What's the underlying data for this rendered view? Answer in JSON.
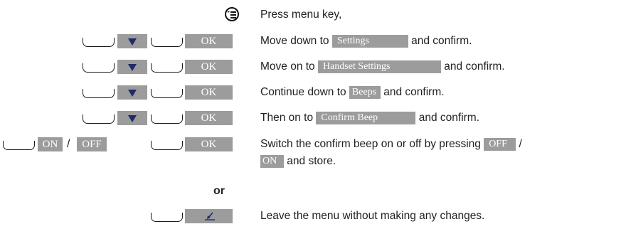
{
  "keys": {
    "down_arrow": "down-triangle-icon",
    "ok": "OK",
    "on": "ON",
    "off": "OFF",
    "slash": "/",
    "escape": "menu-escape-icon",
    "menu_key": "menu-key-icon"
  },
  "steps": [
    {
      "pre": "Press menu key,"
    },
    {
      "pre": "Move down to ",
      "highlight": "Settings",
      "post": " and confirm."
    },
    {
      "pre": "Move on to ",
      "highlight": "Handset Settings",
      "post": " and confirm."
    },
    {
      "pre": "Continue down to ",
      "highlight": "Beeps",
      "post": " and confirm."
    },
    {
      "pre": "Then on to ",
      "highlight": "Confirm Beep",
      "post": " and confirm."
    },
    {
      "pre": "Switch the confirm beep on or off by pressing ",
      "highlight": "OFF",
      "post": " /",
      "line2_highlight": "ON",
      "line2_post": " and store."
    }
  ],
  "or_label": "or",
  "last_step": "Leave the menu without making any changes.",
  "colors": {
    "key_fill": "#9c9c9c",
    "arrow": "#1e2a6a"
  }
}
